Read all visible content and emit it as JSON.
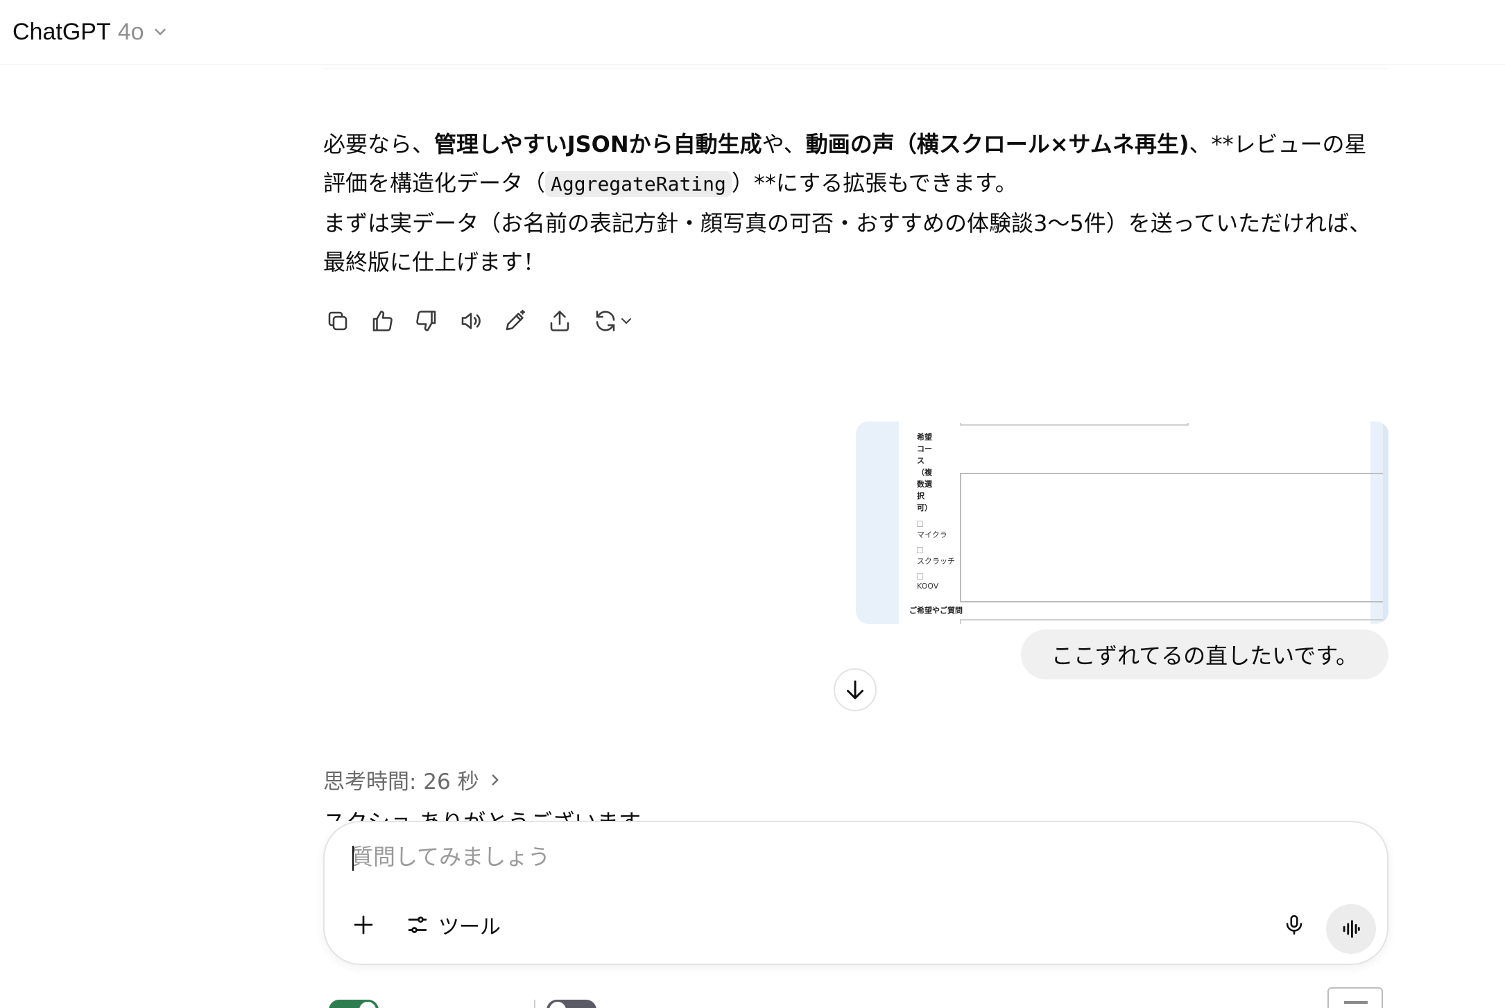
{
  "header": {
    "app_name": "ChatGPT",
    "model_version": "4o",
    "dropdown_icon": "chevron-down-icon"
  },
  "assistant_message": {
    "p1_a": "必要なら、",
    "p1_b": "管理しやすいJSONから自動生成",
    "p1_c": "や、",
    "p1_d": "動画の声（横スクロール×サムネ再生)",
    "p1_e": "、**レビューの星評価を構造化データ（",
    "p1_code": "AggregateRating",
    "p1_f": "）**にする拡張もできます。",
    "p2": "まずは実データ（お名前の表記方針・顔写真の可否・おすすめの体験談3〜5件）を送っていただければ、最終版に仕上げます！",
    "actions": [
      {
        "name": "copy-icon"
      },
      {
        "name": "thumbs-up-icon"
      },
      {
        "name": "thumbs-down-icon"
      },
      {
        "name": "read-aloud-icon"
      },
      {
        "name": "edit-icon"
      },
      {
        "name": "share-icon"
      },
      {
        "name": "regenerate-icon"
      }
    ]
  },
  "user_message": {
    "attachment": {
      "label_course_lines": [
        "希望",
        "コー",
        "ス",
        "（複",
        "数選",
        "択",
        "可）"
      ],
      "options": [
        "マイクラ",
        "スクラッチ",
        "KOOV"
      ],
      "label_question": "ご希望やご質問"
    },
    "text": "ここずれてるの直したいです。"
  },
  "thinking": {
    "label": "思考時間: 26 秒"
  },
  "partial_text": "スクショ ありがとうございます",
  "composer": {
    "placeholder": "質問してみましょう",
    "tools_label": "ツール"
  }
}
